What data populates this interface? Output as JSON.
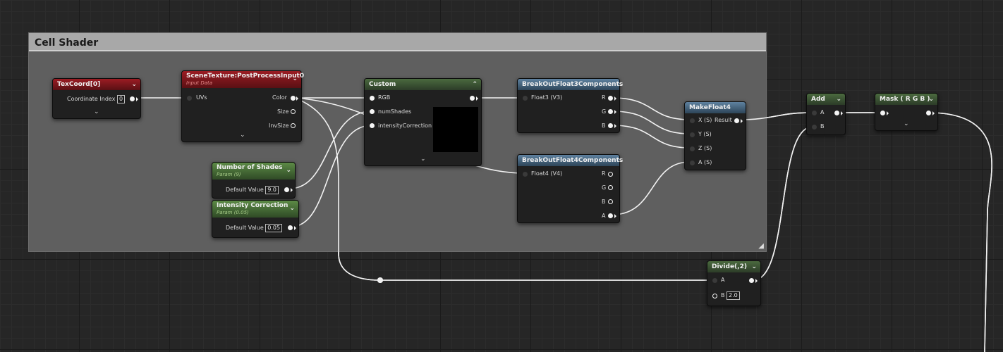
{
  "comment": {
    "title": "Cell Shader"
  },
  "nodes": {
    "texcoord": {
      "title": "TexCoord[0]",
      "coord_label": "Coordinate Index",
      "coord_value": "0"
    },
    "scenetex": {
      "title": "SceneTexture:PostProcessInput0",
      "subtitle": "Input Data",
      "uvs": "UVs",
      "color": "Color",
      "size": "Size",
      "invsize": "InvSize"
    },
    "numshades": {
      "title": "Number of Shades",
      "subtitle": "Param (9)",
      "default_label": "Default Value",
      "default_value": "9.0"
    },
    "intensity": {
      "title": "Intensity Correction",
      "subtitle": "Param (0.05)",
      "default_label": "Default Value",
      "default_value": "0.05"
    },
    "custom": {
      "title": "Custom",
      "rgb": "RGB",
      "numshades": "numShades",
      "intensity": "intensityCorrection"
    },
    "bo3": {
      "title": "BreakOutFloat3Components",
      "input": "Float3 (V3)",
      "r": "R",
      "g": "G",
      "b": "B"
    },
    "bo4": {
      "title": "BreakOutFloat4Components",
      "input": "Float4 (V4)",
      "r": "R",
      "g": "G",
      "b": "B",
      "a": "A"
    },
    "make4": {
      "title": "MakeFloat4",
      "x": "X (S)",
      "y": "Y (S)",
      "z": "Z (S)",
      "a": "A (S)",
      "result": "Result"
    },
    "add": {
      "title": "Add",
      "a": "A",
      "b": "B"
    },
    "mask": {
      "title": "Mask ( R G B )"
    },
    "divide": {
      "title": "Divide(,2)",
      "a": "A",
      "b_label": "B",
      "b_value": "2.0"
    }
  },
  "icons": {
    "collapse": "chevron-down-icon",
    "expand": "chevron-up-icon",
    "resize": "resize-grip-icon"
  },
  "colors": {
    "function_header": "#9b1c23",
    "param_header": "#5c8a46",
    "math_header": "#5f82a0",
    "comment_title": "#a8a8a8",
    "wire": "#ffffff"
  }
}
